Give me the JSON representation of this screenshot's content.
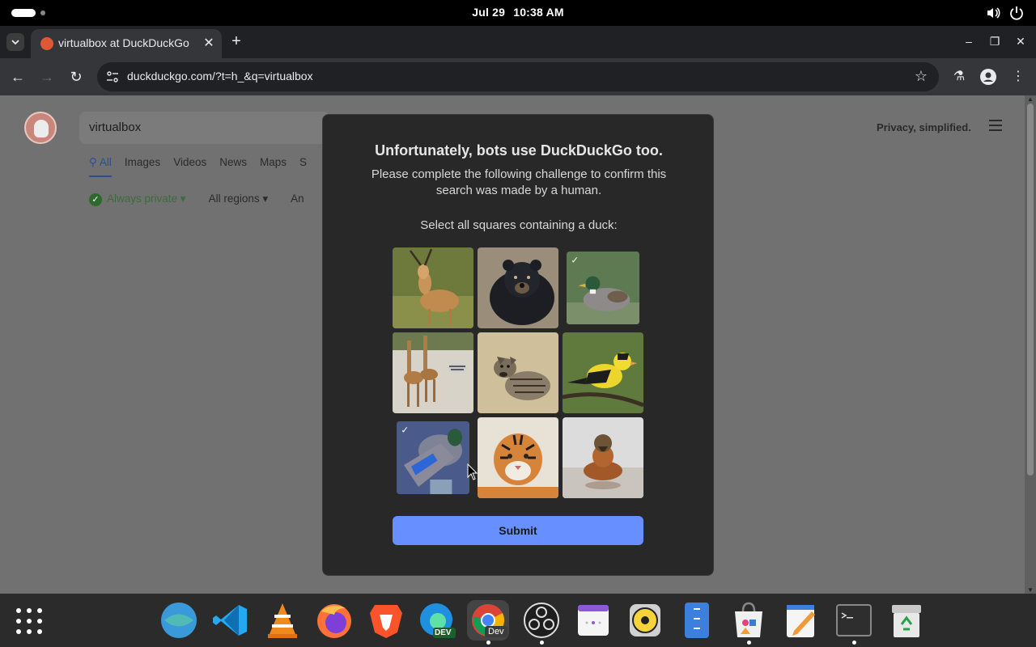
{
  "topbar": {
    "date": "Jul 29",
    "time": "10:38 AM"
  },
  "browser": {
    "tab_title": "virtualbox at DuckDuckGo",
    "url": "duckduckgo.com/?t=h_&q=virtualbox"
  },
  "ddg": {
    "search_query": "virtualbox",
    "nav_tabs": [
      "All",
      "Images",
      "Videos",
      "News",
      "Maps",
      "S"
    ],
    "filter_private": "Always private",
    "filter_regions": "All regions",
    "filter_any": "An",
    "tagline": "Privacy, simplified."
  },
  "challenge": {
    "title": "Unfortunately, bots use DuckDuckGo too.",
    "description": "Please complete the following challenge to confirm this search was made by a human.",
    "prompt": "Select all squares containing a duck:",
    "submit_label": "Submit",
    "tiles": [
      {
        "subject": "antelope",
        "selected": false
      },
      {
        "subject": "black bear",
        "selected": false
      },
      {
        "subject": "mallard duck",
        "selected": true
      },
      {
        "subject": "giraffes and zebra",
        "selected": false
      },
      {
        "subject": "hyena cub",
        "selected": false
      },
      {
        "subject": "goldfinch",
        "selected": false
      },
      {
        "subject": "duck wing closeup",
        "selected": true
      },
      {
        "subject": "tiger",
        "selected": false
      },
      {
        "subject": "duckling",
        "selected": false
      }
    ]
  },
  "dock": {
    "apps": [
      "Web Browser",
      "Visual Studio Code",
      "VLC",
      "Firefox",
      "Brave",
      "Microsoft Edge Dev",
      "Chrome Dev",
      "OBS Studio",
      "Calendar",
      "Rhythmbox",
      "Files",
      "Software",
      "Text Editor",
      "Terminal",
      "Trash"
    ],
    "chrome_badge": "Dev",
    "edge_badge": "DEV"
  },
  "colors": {
    "accent": "#678fff",
    "modal_bg": "#282828",
    "page_dim": "#717171"
  }
}
